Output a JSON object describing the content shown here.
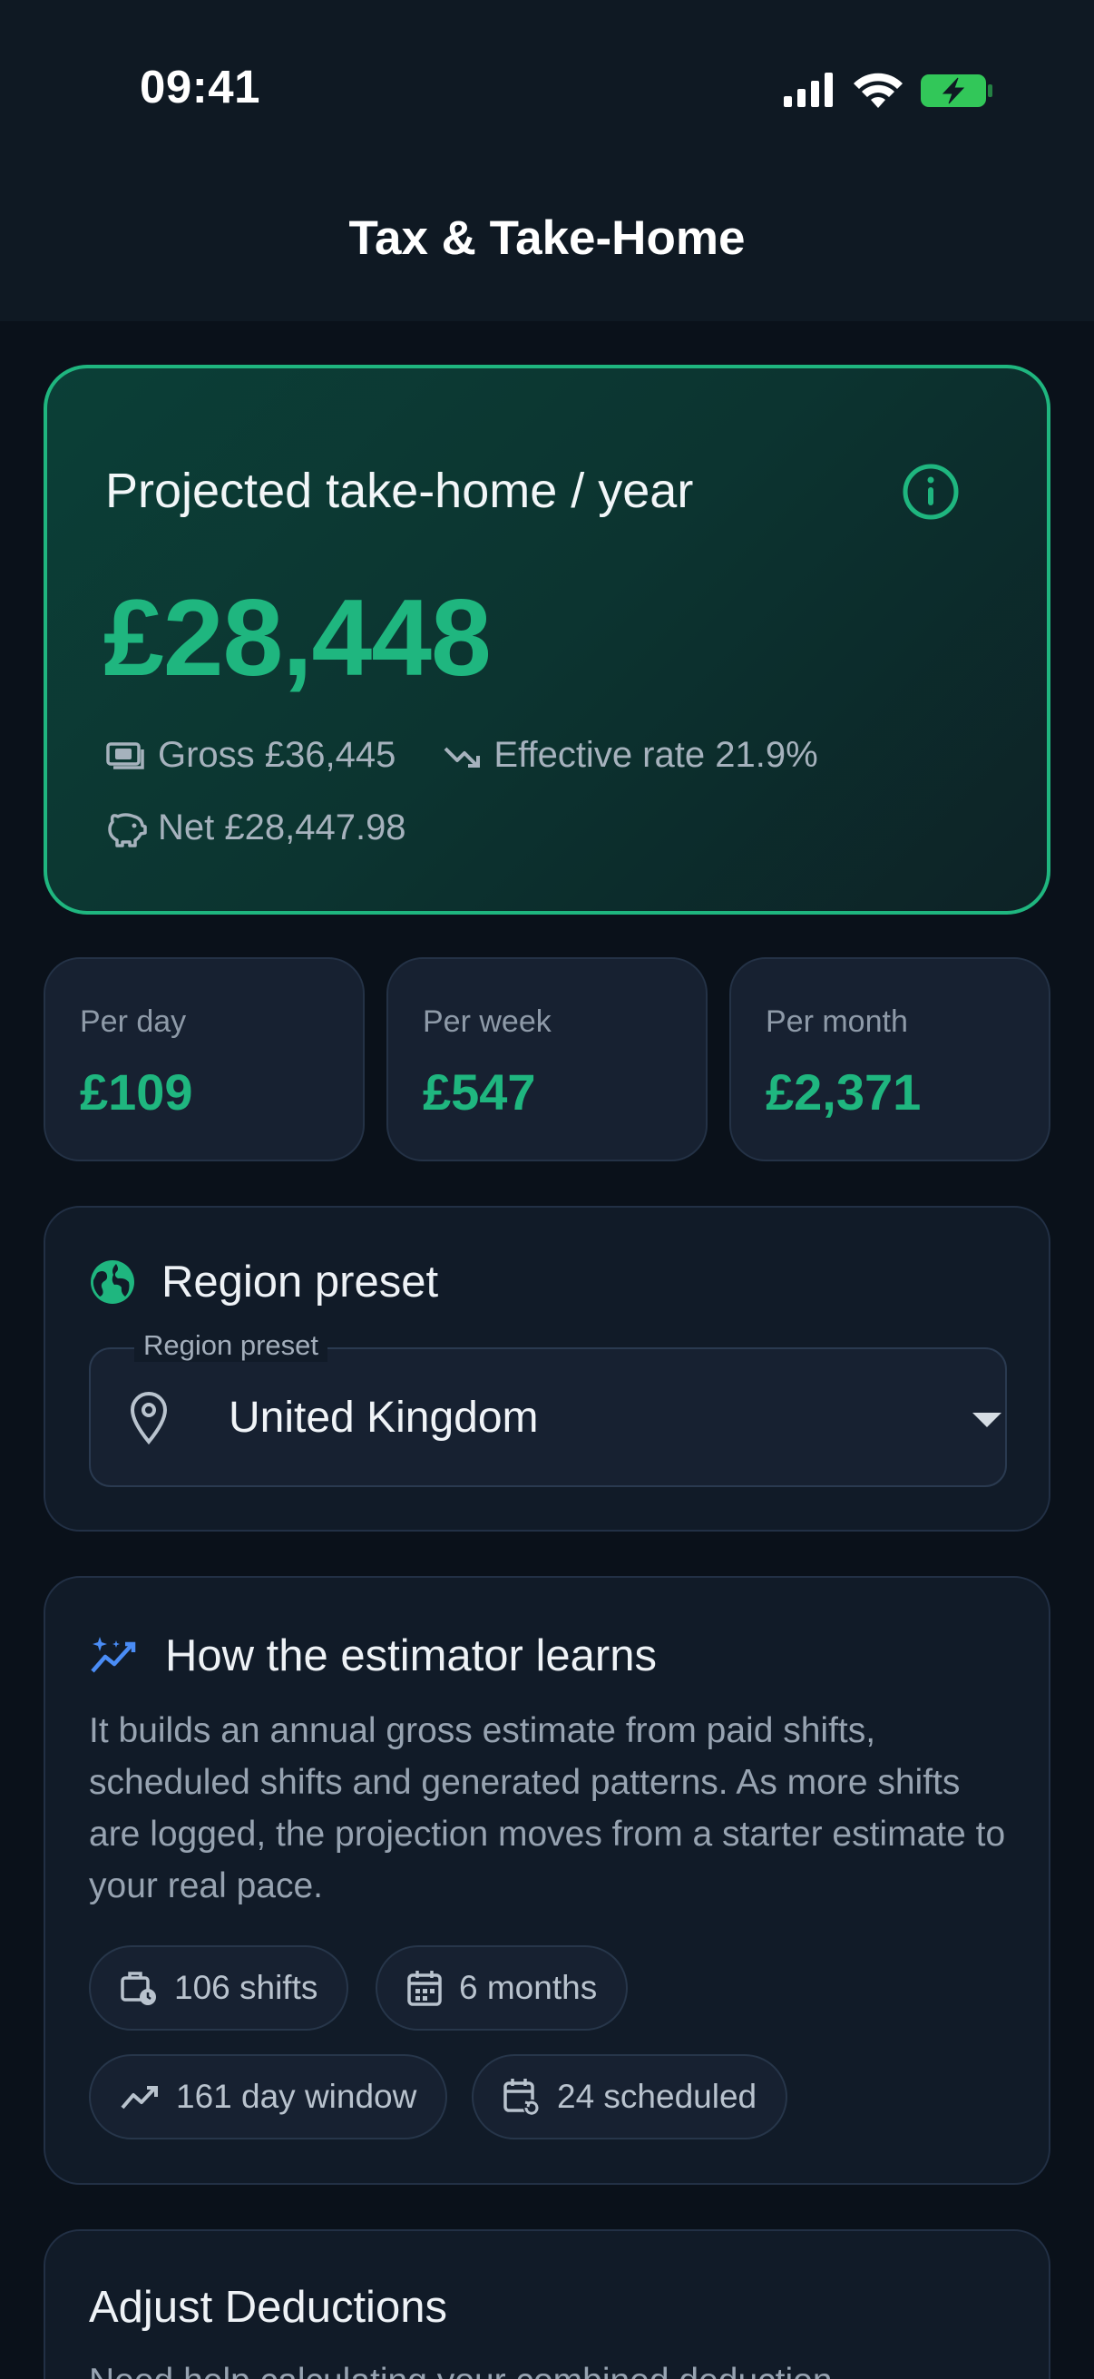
{
  "status_bar": {
    "time": "09:41"
  },
  "header": {
    "title": "Tax & Take-Home"
  },
  "hero": {
    "label": "Projected take-home / year",
    "amount": "£28,448",
    "gross": "Gross £36,445",
    "effective_rate": "Effective rate 21.9%",
    "net": "Net £28,447.98",
    "accent_color": "#1fb67f"
  },
  "periods": [
    {
      "label": "Per day",
      "value": "£109"
    },
    {
      "label": "Per week",
      "value": "£547"
    },
    {
      "label": "Per month",
      "value": "£2,371"
    }
  ],
  "region": {
    "title": "Region preset",
    "field_label": "Region preset",
    "selected": "United Kingdom",
    "icon": "globe-icon"
  },
  "estimator": {
    "title": "How the estimator learns",
    "description": "It builds an annual gross estimate from paid shifts, scheduled shifts and generated patterns. As more shifts are logged, the projection moves from a starter estimate to your real pace.",
    "chips": [
      {
        "label": "106 shifts",
        "icon": "briefcase-clock-icon"
      },
      {
        "label": "6 months",
        "icon": "calendar-icon"
      },
      {
        "label": "161 day window",
        "icon": "trend-up-icon"
      },
      {
        "label": "24 scheduled",
        "icon": "calendar-refresh-icon"
      }
    ]
  },
  "deductions": {
    "title": "Adjust Deductions",
    "description": "Need help calculating your combined deduction"
  }
}
